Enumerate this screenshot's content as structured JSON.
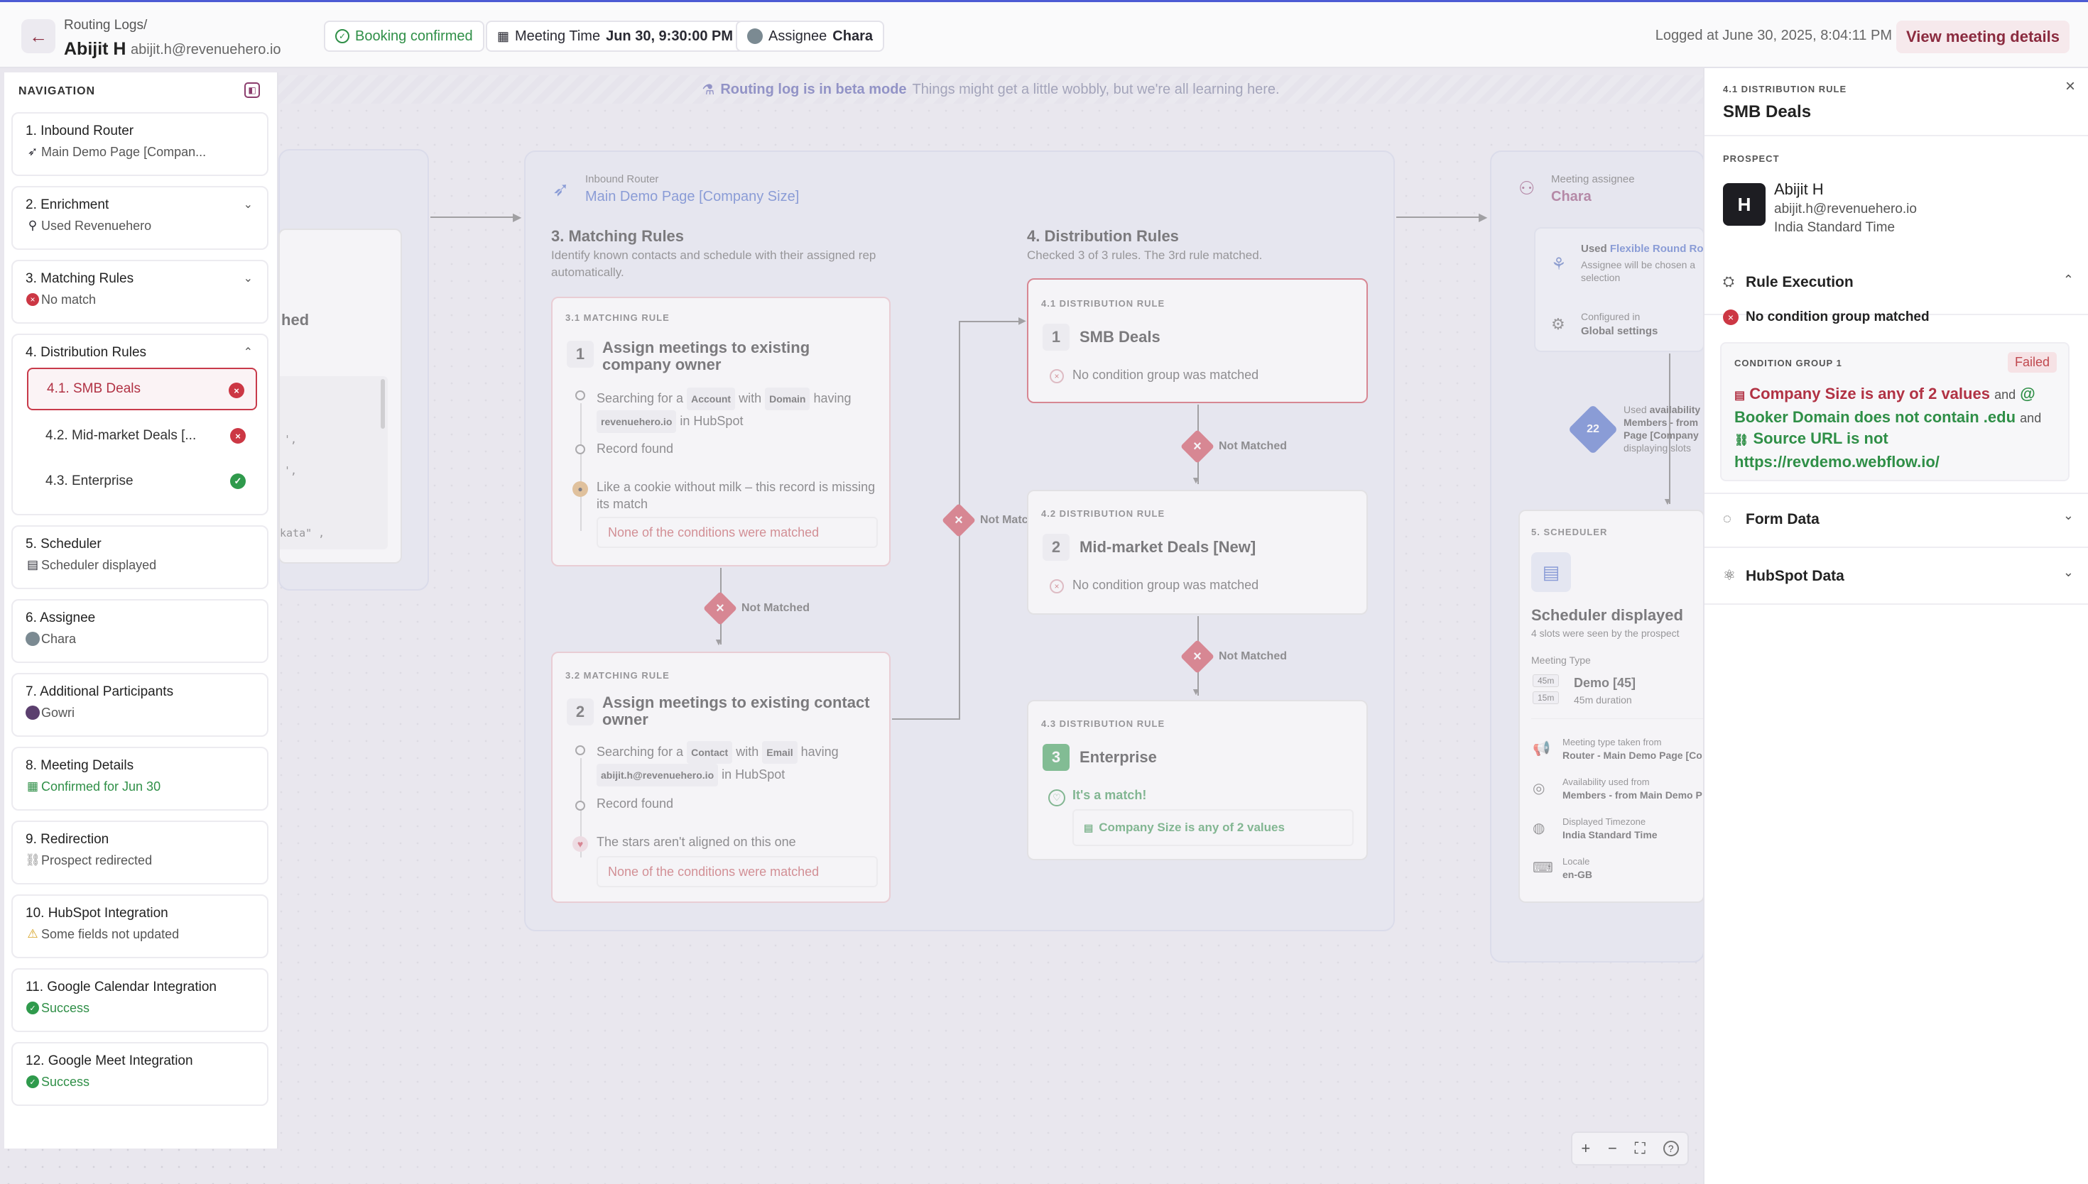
{
  "header": {
    "breadcrumb": "Routing Logs/",
    "name": "Abijit H",
    "email": "abijit.h@revenuehero.io",
    "booking_status": "Booking confirmed",
    "meeting_time_label": "Meeting Time",
    "meeting_time_value": "Jun 30, 9:30:00 PM",
    "assignee_label": "Assignee",
    "assignee_value": "Chara",
    "logged_at": "Logged at June 30, 2025, 8:04:11 PM",
    "view_button": "View meeting details"
  },
  "beta": {
    "title": "Routing log is in beta mode",
    "subtitle": "Things might get a little wobbly, but we're all learning here."
  },
  "nav": {
    "title": "NAVIGATION",
    "items": [
      {
        "title": "1. Inbound Router",
        "status": "Main Demo Page [Compan..."
      },
      {
        "title": "2. Enrichment",
        "status": "Used Revenuehero"
      },
      {
        "title": "3. Matching Rules",
        "status": "No match"
      },
      {
        "title": "4. Distribution Rules",
        "status": ""
      },
      {
        "title": "5. Scheduler",
        "status": "Scheduler displayed"
      },
      {
        "title": "6. Assignee",
        "status": "Chara"
      },
      {
        "title": "7. Additional Participants",
        "status": "Gowri"
      },
      {
        "title": "8. Meeting Details",
        "status": "Confirmed for Jun 30"
      },
      {
        "title": "9. Redirection",
        "status": "Prospect redirected"
      },
      {
        "title": "10. HubSpot Integration",
        "status": "Some fields not updated"
      },
      {
        "title": "11. Google Calendar Integration",
        "status": "Success"
      },
      {
        "title": "12. Google Meet Integration",
        "status": "Success"
      }
    ],
    "sub_items": [
      "4.1. SMB Deals",
      "4.2. Mid-market Deals [...",
      "4.3. Enterprise"
    ]
  },
  "left_card": {
    "partial_text": "hed",
    "code_line1": "',",
    "code_line2": "',",
    "code_line3": "kata\" ,"
  },
  "router": {
    "label": "Inbound Router",
    "name": "Main Demo Page [Company Size]"
  },
  "matching": {
    "title": "3. Matching Rules",
    "desc": "Identify known contacts and schedule with their assigned rep automatically.",
    "rules": [
      {
        "cap": "3.1 MATCHING RULE",
        "num": "1",
        "title": "Assign meetings to existing company owner",
        "search_prefix": "Searching for a",
        "object": "Account",
        "with": "with",
        "field": "Domain",
        "having": "having",
        "value": "revenuehero.io",
        "in": "in HubSpot",
        "record": "Record found",
        "quip": "Like a cookie without milk – this record is missing its match",
        "result": "None of the conditions were matched"
      },
      {
        "cap": "3.2 MATCHING RULE",
        "num": "2",
        "title": "Assign meetings to existing contact owner",
        "search_prefix": "Searching for a",
        "object": "Contact",
        "with": "with",
        "field": "Email",
        "having": "having",
        "value": "abijit.h@revenuehero.io",
        "in": "in HubSpot",
        "record": "Record found",
        "quip": "The stars aren't aligned on this one",
        "result": "None of the conditions were matched"
      }
    ],
    "not_matched": "Not Matched",
    "not_matched_side": "Not Match"
  },
  "distribution": {
    "title": "4. Distribution Rules",
    "desc": "Checked 3 of 3 rules. The 3rd rule matched.",
    "rules": [
      {
        "cap": "4.1 DISTRIBUTION RULE",
        "num": "1",
        "title": "SMB Deals",
        "result": "No condition group was matched"
      },
      {
        "cap": "4.2 DISTRIBUTION RULE",
        "num": "2",
        "title": "Mid-market Deals [New]",
        "result": "No condition group was matched"
      },
      {
        "cap": "4.3 DISTRIBUTION RULE",
        "num": "3",
        "title": "Enterprise",
        "result": "It's a match!",
        "condition": "Company Size is any of 2 values"
      }
    ],
    "not_matched": "Not Matched"
  },
  "assignee_group": {
    "label": "Meeting assignee",
    "name": "Chara",
    "used_prefix": "Used",
    "used_link": "Flexible Round Rol",
    "used_sub": "Assignee will be chosen a selection",
    "configured": "Configured in",
    "configured_value": "Global settings",
    "avail_used": "Used",
    "avail_bold": "availability",
    "avail_line2": "Members - from",
    "avail_line3": "Page [Company",
    "avail_line4": "displaying slots",
    "calendar_day": "22"
  },
  "scheduler": {
    "cap": "5. SCHEDULER",
    "title": "Scheduler displayed",
    "sub": "4 slots were seen by the prospect",
    "meeting_type_label": "Meeting Type",
    "dur1": "45m",
    "dur2": "15m",
    "meeting_type": "Demo [45]",
    "meeting_duration": "45m duration",
    "rows": [
      {
        "label": "Meeting type taken from",
        "value": "Router - Main Demo Page [Co"
      },
      {
        "label": "Availability used from",
        "value": "Members - from Main Demo P"
      },
      {
        "label": "Displayed Timezone",
        "value": "India Standard Time"
      },
      {
        "label": "Locale",
        "value": "en-GB"
      }
    ]
  },
  "panel": {
    "cap": "4.1 DISTRIBUTION RULE",
    "title": "SMB Deals",
    "prospect_label": "PROSPECT",
    "prospect_name": "Abijit H",
    "prospect_email": "abijit.h@revenuehero.io",
    "prospect_tz": "India Standard Time",
    "rule_exec": "Rule Execution",
    "no_match": "No condition group matched",
    "cg_label": "CONDITION GROUP 1",
    "cg_status": "Failed",
    "cond1": "Company Size is any of 2 values",
    "and": "and",
    "cond2": "Booker Domain does not contain .edu",
    "cond3": "Source URL is not",
    "cond3_value": "https://revdemo.webflow.io/",
    "form_data": "Form Data",
    "hubspot_data": "HubSpot Data"
  },
  "zoom": {
    "plus": "+",
    "minus": "−",
    "fit": "⛶",
    "help": "?"
  }
}
